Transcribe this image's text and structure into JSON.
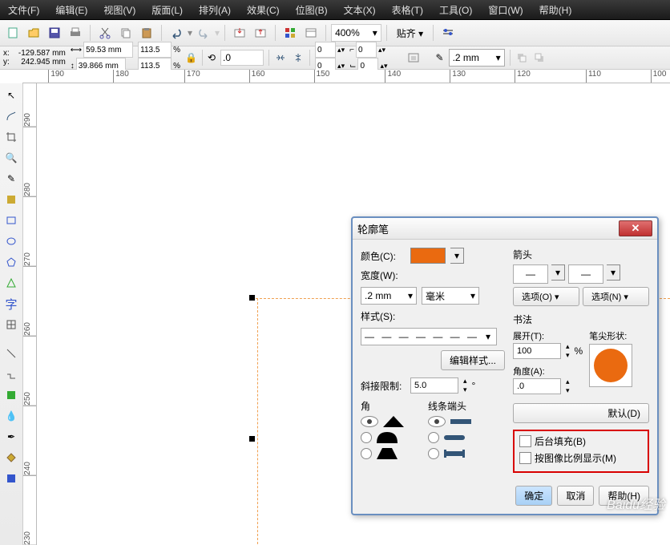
{
  "menu": {
    "file": "文件(F)",
    "edit": "编辑(E)",
    "view": "视图(V)",
    "layout": "版面(L)",
    "arrange": "排列(A)",
    "effects": "效果(C)",
    "bitmap": "位图(B)",
    "text": "文本(X)",
    "table": "表格(T)",
    "tools": "工具(O)",
    "window": "窗口(W)",
    "help": "帮助(H)"
  },
  "toolbar": {
    "zoom": "400%",
    "paste": "贴齐 ▾"
  },
  "prop": {
    "x_lbl": "x:",
    "y_lbl": "y:",
    "x": "-129.587 mm",
    "y": "242.945 mm",
    "w": "59.53 mm",
    "h": "39.866 mm",
    "sx": "113.5",
    "sy": "113.5",
    "rot": ".0",
    "outline": ".2 mm"
  },
  "ruler_h": [
    "190",
    "180",
    "170",
    "160",
    "150",
    "140",
    "130",
    "120",
    "110",
    "100"
  ],
  "ruler_v": [
    "290",
    "280",
    "270",
    "260",
    "250",
    "240",
    "230"
  ],
  "dialog": {
    "title": "轮廓笔",
    "color_lbl": "颜色(C):",
    "width_lbl": "宽度(W):",
    "width_val": ".2 mm",
    "width_unit": "毫米",
    "style_lbl": "样式(S):",
    "style_val": "— — — — — — —",
    "edit_style": "编辑样式...",
    "miter_lbl": "斜接限制:",
    "miter_val": "5.0",
    "miter_deg": "°",
    "corner_lbl": "角",
    "cap_lbl": "线条端头",
    "arrow_lbl": "箭头",
    "opt_left": "选项(O)  ▾",
    "opt_right": "选项(N)  ▾",
    "calli_lbl": "书法",
    "spread_lbl": "展开(T):",
    "spread_val": "100",
    "spread_pct": "%",
    "nib_lbl": "笔尖形状:",
    "angle_lbl": "角度(A):",
    "angle_val": ".0",
    "default_btn": "默认(D)",
    "behind_lbl": "后台填充(B)",
    "scale_lbl": "按图像比例显示(M)",
    "ok": "确定",
    "cancel": "取消",
    "help": "帮助(H)"
  },
  "watermark": "Baidu经验"
}
